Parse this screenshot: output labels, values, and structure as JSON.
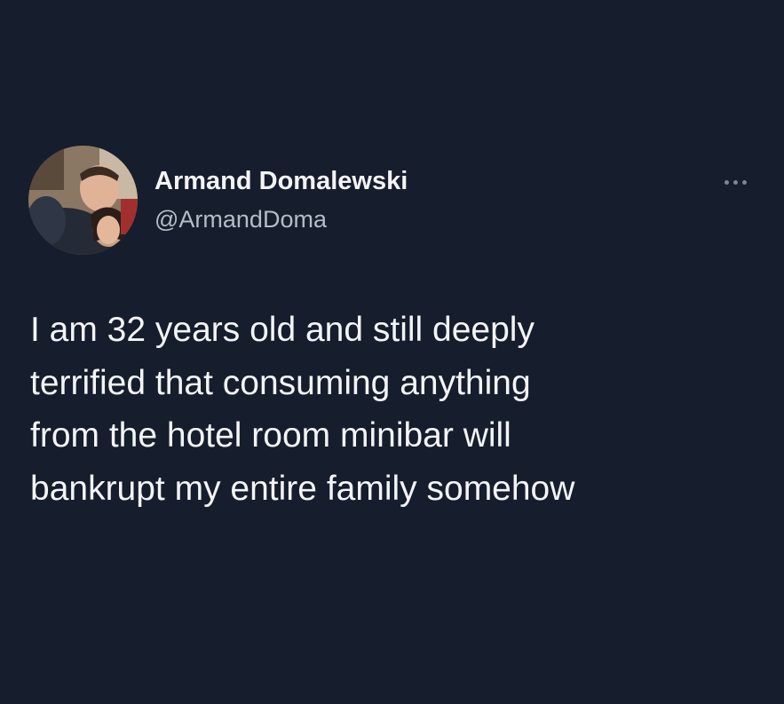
{
  "tweet": {
    "author": {
      "display_name": "Armand Domalewski",
      "handle": "@ArmandDoma",
      "avatar_icon": "avatar-photo"
    },
    "more_icon": "more-options-icon",
    "text": "I am 32 years old and still deeply\nterrified that consuming anything\nfrom the hotel room minibar will\nbankrupt my entire family somehow"
  },
  "theme": {
    "background": "#161d2d",
    "text": "#f3f4f6",
    "muted_text": "#b4bcc6",
    "icon": "#7d8590"
  }
}
